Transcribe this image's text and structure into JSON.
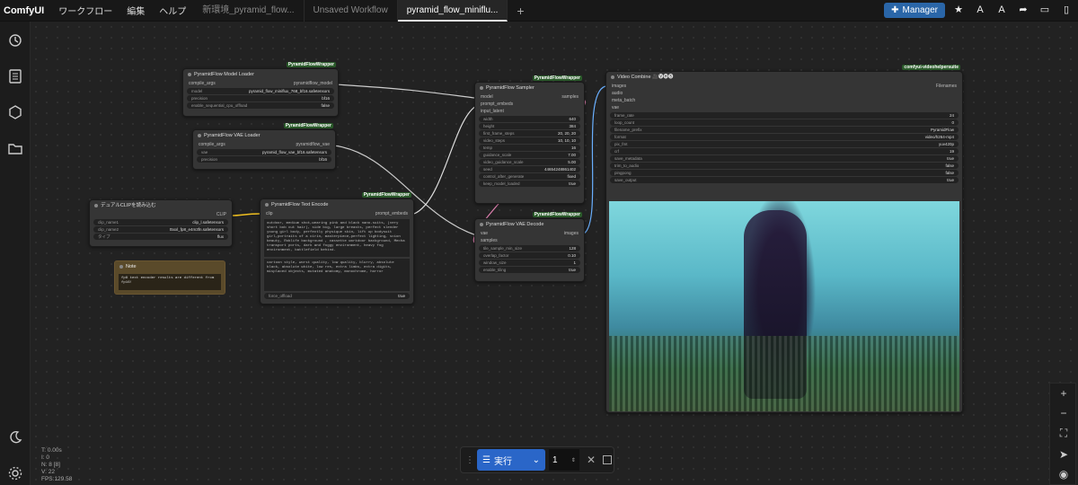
{
  "app": {
    "name": "ComfyUI"
  },
  "menu": [
    "ワークフロー",
    "編集",
    "ヘルプ"
  ],
  "tabs": [
    "新環境_pyramid_flow...",
    "Unsaved Workflow",
    "pyramid_flow_miniflu..."
  ],
  "manager_label": "Manager",
  "nodes": {
    "model_loader": {
      "title": "PyramidFlow Model Loader",
      "badge": "PyramidFlowWrapper",
      "in": "compile_args",
      "out": "pyramidflow_model",
      "widgets": [
        [
          "model",
          "pyramid_flow_miniflux_768_bf16.safetensors"
        ],
        [
          "precision",
          "bf16"
        ],
        [
          "enable_sequential_cpu_offload",
          "false"
        ]
      ]
    },
    "vae_loader": {
      "title": "PyramidFlow VAE Loader",
      "badge": "PyramidFlowWrapper",
      "in": "compile_args",
      "out": "pyramidflow_vae",
      "widgets": [
        [
          "vae",
          "pyramid_flow_vae_bf16.safetensors"
        ],
        [
          "precision",
          "bf16"
        ]
      ]
    },
    "clip": {
      "title": "デュアルCLIPを読み込む",
      "out": "CLIP",
      "widgets": [
        [
          "clip_name1",
          "clip_l.safetensors"
        ],
        [
          "clip_name2",
          "t5xxl_fp8_e4m3fn.safetensors"
        ],
        [
          "タイプ",
          "flux"
        ]
      ]
    },
    "note": {
      "title": "Note",
      "text": "fp8 text encoder results are different from fp16!"
    },
    "text_encode": {
      "title": "PyramidFlow Text Encode",
      "badge": "PyramidFlowWrapper",
      "in": "clip",
      "out": "prompt_embeds",
      "positive": "outdoor, medium shot,wearing pink and black nano-suits, (very short bob cut hair), side big, large breasts, perfect slender young girl body, perfectly physique skin, lift up bodysuit girl,portraits of a cirin, masterpiece,perfect lighting, scion beauty, Roblife background , cassette workdoor background, Mecha transport ports, dark and foggy environment, heavy fog environment, battlefield behind.",
      "negative": "cartoon style, worst quality, low quality, blurry, absolute black, absolute white, low res, extra limbs, extra digits, misplaced objects, mutated anatomy, monochrome, horror",
      "widget": [
        "force_offload",
        "true"
      ]
    },
    "sampler": {
      "title": "PyramidFlow Sampler",
      "badge": "PyramidFlowWrapper",
      "inputs": [
        "model",
        "prompt_embeds",
        "input_latent"
      ],
      "out": "samples",
      "widgets": [
        [
          "width",
          "640"
        ],
        [
          "height",
          "384"
        ],
        [
          "first_frame_steps",
          "20, 20, 20"
        ],
        [
          "video_steps",
          "10, 10, 10"
        ],
        [
          "temp",
          "16"
        ],
        [
          "guidance_scale",
          "7.00"
        ],
        [
          "video_guidance_scale",
          "5.00"
        ],
        [
          "seed",
          "44654248861402"
        ],
        [
          "control_after_generate",
          "fixed"
        ],
        [
          "keep_model_loaded",
          "true"
        ]
      ]
    },
    "decode": {
      "title": "PyramidFlow VAE Decode",
      "badge": "PyramidFlowWrapper",
      "inputs": [
        "vae",
        "samples"
      ],
      "out": "images",
      "widgets": [
        [
          "tile_sample_min_size",
          "128"
        ],
        [
          "overlap_factor",
          "0.10"
        ],
        [
          "window_size",
          "1"
        ],
        [
          "enable_tiling",
          "true"
        ]
      ]
    },
    "video": {
      "title": "Video Combine 🎥🅥🅗🅢",
      "badge": "comfyui-videohelpersuite",
      "inputs": [
        "images",
        "audio",
        "meta_batch",
        "vae"
      ],
      "out": "Filenames",
      "widgets": [
        [
          "frame_rate",
          "24"
        ],
        [
          "loop_count",
          "0"
        ],
        [
          "filename_prefix",
          "PyramidFlow"
        ],
        [
          "format",
          "video/h264-mp4"
        ],
        [
          "pix_fmt",
          "yuv420p"
        ],
        [
          "crf",
          "19"
        ],
        [
          "save_metadata",
          "true"
        ],
        [
          "trim_to_audio",
          "false"
        ],
        [
          "pingpong",
          "false"
        ],
        [
          "save_output",
          "true"
        ]
      ]
    }
  },
  "run": {
    "label": "実行",
    "count": "1"
  },
  "stats": [
    "T: 0.00s",
    "I: 0",
    "N: 8 [8]",
    "V: 22",
    "FPS:129.58"
  ]
}
